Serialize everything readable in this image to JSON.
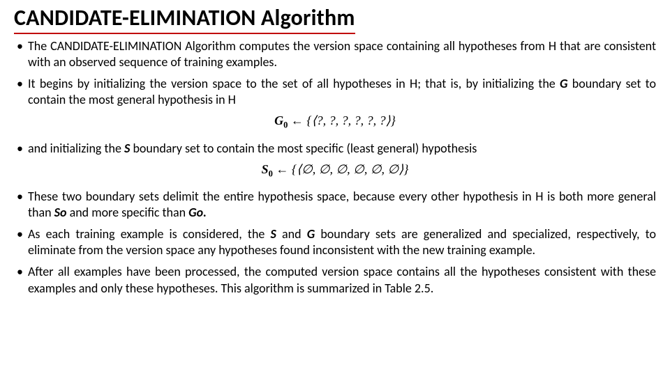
{
  "title": "CANDIDATE-ELIMINATION Algorithm",
  "bullets": {
    "b1": "The CANDIDATE-ELIMINATION Algorithm computes the version space containing all hypotheses from H that are consistent with an observed sequence of training examples.",
    "b2_a": "It begins by initializing the version space to the set of all hypotheses in H; that is, by initializing the ",
    "b2_g": "G",
    "b2_b": " boundary set to contain the most general hypothesis in H",
    "b3_a": "and initializing the ",
    "b3_s": "S",
    "b3_b": " boundary set to contain the most specific (least general) hypothesis",
    "b4_a": "These two boundary sets delimit the entire hypothesis space, because every other hypothesis in H is both more general than ",
    "b4_so": "So",
    "b4_b": " and more specific than ",
    "b4_go": "Go.",
    "b5_a": "As each training example is considered, the ",
    "b5_s": "S",
    "b5_b": " and ",
    "b5_g": "G",
    "b5_c": " boundary sets are generalized and specialized, respectively, to eliminate from the version space any hypotheses found inconsistent with the new training example.",
    "b6": " After all examples have been processed, the computed version space contains all the hypotheses consistent with these examples and only these hypotheses. This algorithm is summarized in Table 2.5."
  },
  "formulas": {
    "g0_lhs_sym": "G",
    "g0_lhs_sub": "0",
    "g0_arrow": " ← ",
    "g0_rhs": "{⟨?, ?, ?, ?, ?, ?⟩}",
    "s0_lhs_sym": "S",
    "s0_lhs_sub": "0",
    "s0_arrow": " ← ",
    "s0_rhs": "{⟨∅, ∅, ∅, ∅, ∅, ∅⟩}"
  }
}
